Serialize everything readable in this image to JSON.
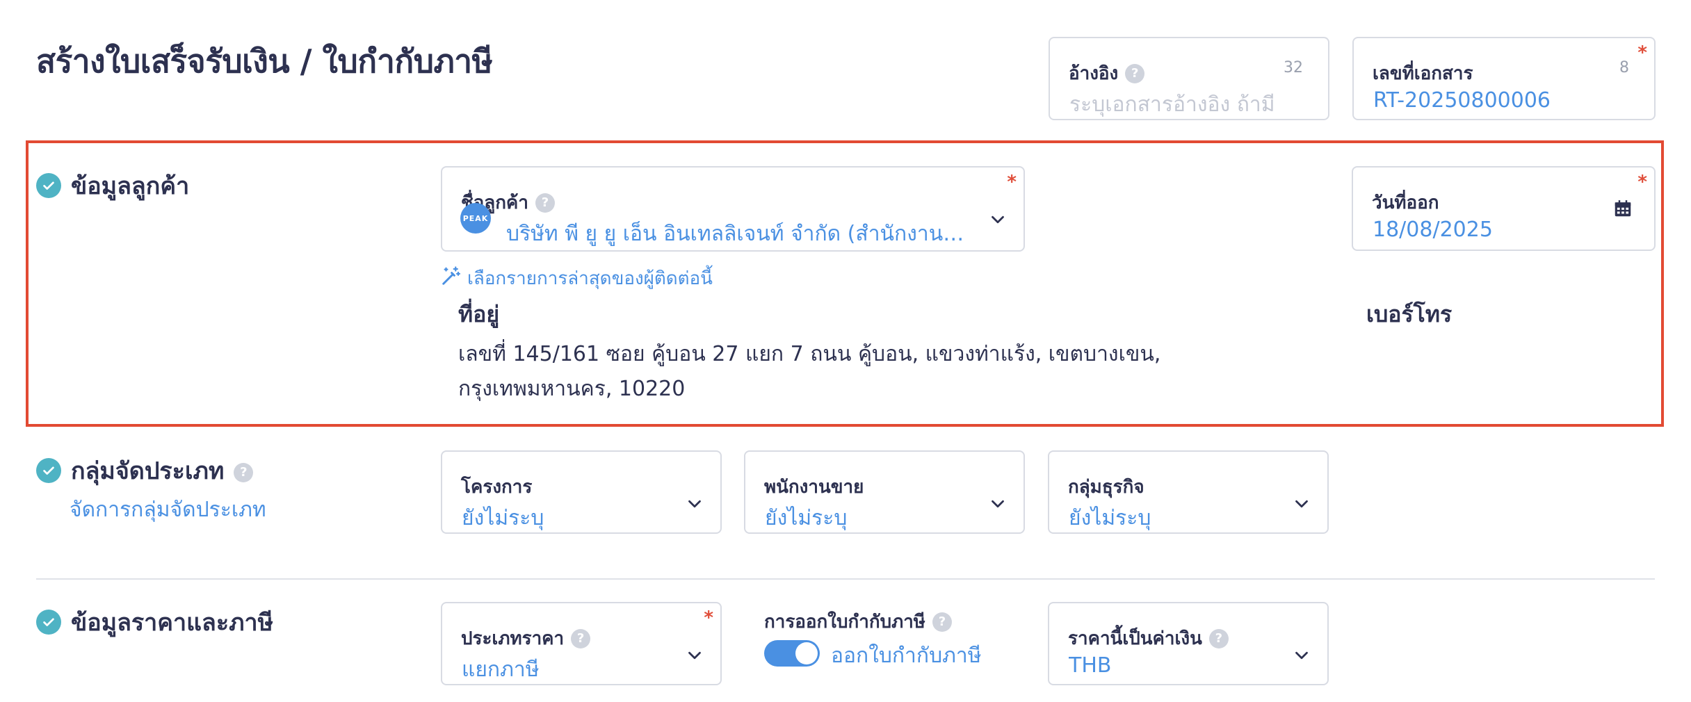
{
  "page": {
    "title": "สร้างใบเสร็จรับเงิน / ใบกำกับภาษี"
  },
  "reference": {
    "label": "อ้างอิง",
    "counter": "32",
    "placeholder": "ระบุเอกสารอ้างอิง ถ้ามี"
  },
  "doc_number": {
    "label": "เลขที่เอกสาร",
    "counter": "8",
    "required": "*",
    "value": "RT-20250800006"
  },
  "customer_section": {
    "title": "ข้อมูลลูกค้า",
    "customer_name": {
      "label": "ชื่อลูกค้า",
      "required": "*",
      "avatar_text": "PEAK",
      "value": "บริษัท พี ยู ยู เอ็น อินเทลลิเจนท์ จำกัด (สำนักงานให..."
    },
    "issue_date": {
      "label": "วันที่ออก",
      "required": "*",
      "value": "18/08/2025"
    },
    "suggest_link": "เลือกรายการล่าสุดของผู้ติดต่อนี้",
    "address_label": "ที่อยู่",
    "address_value": "เลขที่ 145/161 ซอย คู้บอน 27 แยก 7 ถนน คู้บอน, แขวงท่าแร้ง, เขตบางเขน, กรุงเทพมหานคร, 10220",
    "phone_label": "เบอร์โทร"
  },
  "category_section": {
    "title": "กลุ่มจัดประเภท",
    "manage_link": "จัดการกลุ่มจัดประเภท",
    "project": {
      "label": "โครงการ",
      "value": "ยังไม่ระบุ"
    },
    "salesperson": {
      "label": "พนักงานขาย",
      "value": "ยังไม่ระบุ"
    },
    "business_group": {
      "label": "กลุ่มธุรกิจ",
      "value": "ยังไม่ระบุ"
    }
  },
  "price_section": {
    "title": "ข้อมูลราคาและภาษี",
    "price_type": {
      "label": "ประเภทราคา",
      "required": "*",
      "value": "แยกภาษี"
    },
    "tax_invoice": {
      "label": "การออกใบกำกับภาษี",
      "toggle_label": "ออกใบกำกับภาษี",
      "enabled": true
    },
    "currency": {
      "label": "ราคานี้เป็นค่าเงิน",
      "value": "THB"
    }
  },
  "colors": {
    "accent": "#4a90e2",
    "check": "#4fb3c4",
    "highlight": "#e24a33",
    "required": "#e04e3a"
  }
}
